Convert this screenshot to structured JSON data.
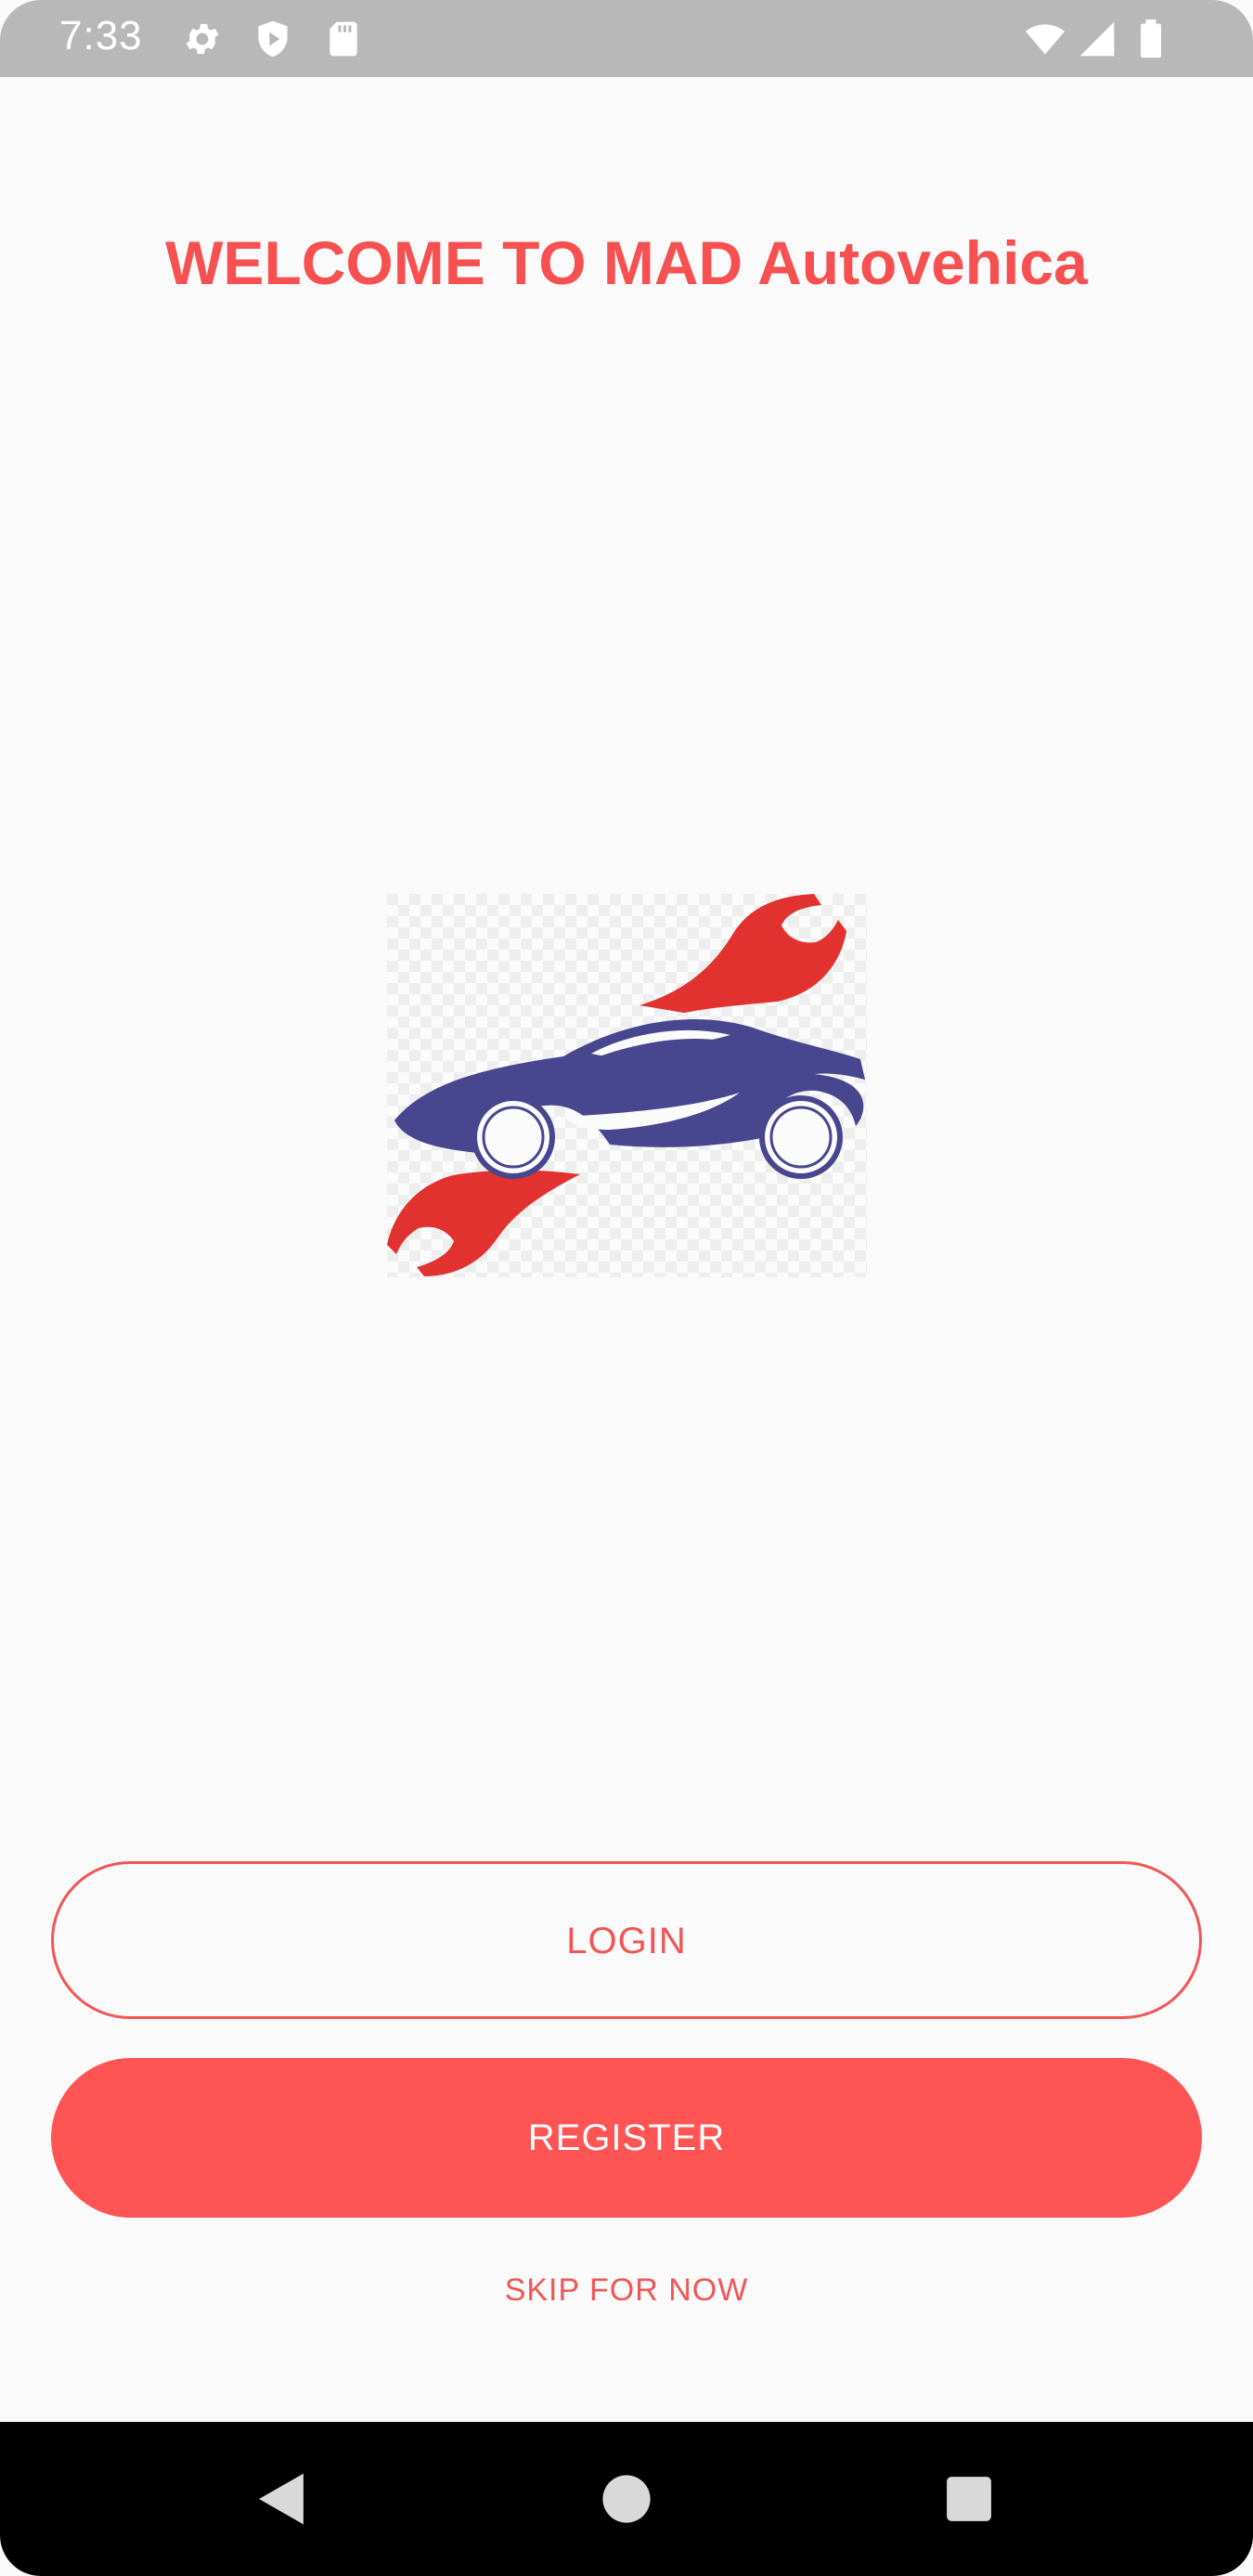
{
  "status_bar": {
    "time": "7:33",
    "icons_left": [
      "gear-icon",
      "play-protect-icon",
      "sd-card-icon"
    ],
    "icons_right": [
      "wifi-icon",
      "cell-signal-icon",
      "battery-icon"
    ]
  },
  "main": {
    "title": "WELCOME TO MAD Autovehica",
    "logo": "car-wrench-logo"
  },
  "buttons": {
    "login_label": "LOGIN",
    "register_label": "REGISTER",
    "skip_label": "SKIP FOR NOW"
  },
  "nav_bar": {
    "items": [
      "back-icon",
      "home-icon",
      "recents-icon"
    ]
  },
  "colors": {
    "accent": "#ff5454",
    "status_bar": "#b8b8b8",
    "background": "#fafafa",
    "logo_red": "#e2322f",
    "logo_blue": "#47468f"
  }
}
